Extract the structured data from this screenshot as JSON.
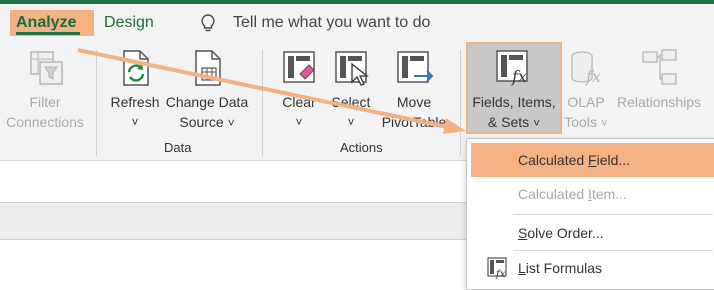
{
  "tabs": {
    "analyze": "Analyze",
    "design": "Design"
  },
  "tell_me": "Tell me what you want to do",
  "buttons": {
    "filter_line1": "Filter",
    "filter_line2": "Connections",
    "refresh": "Refresh",
    "change_line1": "Change Data",
    "change_line2": "Source",
    "clear": "Clear",
    "select": "Select",
    "move_line1": "Move",
    "move_line2": "PivotTable",
    "fis_line1": "Fields, Items,",
    "fis_line2": "& Sets",
    "olap_line1": "OLAP",
    "olap_line2": "Tools",
    "relationships": "Relationships"
  },
  "groups": {
    "data": "Data",
    "actions": "Actions"
  },
  "menu": {
    "calc_field_pre": "Calculated ",
    "calc_field_u": "F",
    "calc_field_post": "ield...",
    "calc_item_pre": "Calculated ",
    "calc_item_u": "I",
    "calc_item_post": "tem...",
    "solve_u": "S",
    "solve_post": "olve Order...",
    "list_u": "L",
    "list_post": "ist Formulas"
  },
  "colors": {
    "accent_green": "#217346",
    "highlight": "#f4b183",
    "arrow": "#f4b183"
  },
  "icons": [
    "lightbulb-icon",
    "filter-connections-icon",
    "refresh-icon",
    "change-data-source-icon",
    "clear-icon",
    "select-icon",
    "move-pivottable-icon",
    "fields-items-sets-icon",
    "olap-tools-icon",
    "relationships-icon",
    "list-formulas-icon"
  ]
}
